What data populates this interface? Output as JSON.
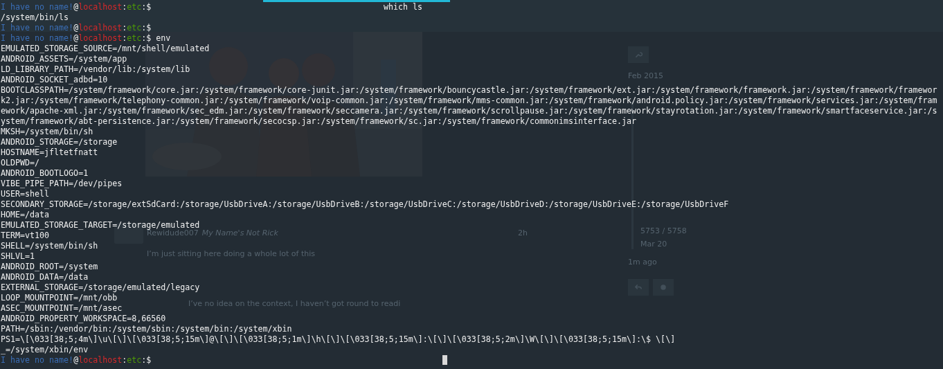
{
  "page": {
    "post": {
      "author": "Rewidude007",
      "author_title": "My Name's Not Rick",
      "age": "2h",
      "text": "I’m just sitting here doing a whole lot of this",
      "quote_text": "I’ve no idea on the context, I haven’t got round to readi"
    },
    "timeline": {
      "start": "Feb 2015",
      "position": "5753 / 5758",
      "date": "Mar 20",
      "ago": "1m ago"
    }
  },
  "terminal": {
    "title": "which ls",
    "lines": [
      {
        "kind": "prompt",
        "parts": [
          {
            "text": "I have no name!",
            "color": "#3a6db5"
          },
          {
            "text": "@",
            "color": "#f0f0f0"
          },
          {
            "text": "localhost",
            "color": "#d6282a"
          },
          {
            "text": ":"
          },
          {
            "text": "etc",
            "color": "#4e9a06"
          },
          {
            "text": ":$",
            "color": "#f0f0f0"
          }
        ]
      },
      {
        "kind": "output",
        "text": "/system/bin/ls"
      },
      {
        "kind": "prompt",
        "parts": [
          {
            "text": "I have no name!",
            "color": "#3a6db5"
          },
          {
            "text": "@",
            "color": "#f0f0f0"
          },
          {
            "text": "localhost",
            "color": "#d6282a"
          },
          {
            "text": ":"
          },
          {
            "text": "etc",
            "color": "#4e9a06"
          },
          {
            "text": ":$",
            "color": "#f0f0f0"
          }
        ]
      },
      {
        "kind": "prompt",
        "parts": [
          {
            "text": "I have no name!",
            "color": "#3a6db5"
          },
          {
            "text": "@",
            "color": "#f0f0f0"
          },
          {
            "text": "localhost",
            "color": "#d6282a"
          },
          {
            "text": ":"
          },
          {
            "text": "etc",
            "color": "#4e9a06"
          },
          {
            "text": ":$",
            "color": "#f0f0f0"
          }
        ],
        "command": "env"
      },
      {
        "kind": "output",
        "text": "EMULATED_STORAGE_SOURCE=/mnt/shell/emulated"
      },
      {
        "kind": "output",
        "text": "ANDROID_ASSETS=/system/app"
      },
      {
        "kind": "output",
        "text": "LD_LIBRARY_PATH=/vendor/lib:/system/lib"
      },
      {
        "kind": "output",
        "text": "ANDROID_SOCKET_adbd=10"
      },
      {
        "kind": "output",
        "text": "BOOTCLASSPATH=/system/framework/core.jar:/system/framework/core-junit.jar:/system/framework/bouncycastle.jar:/system/framework/ext.jar:/system/framework/framework.jar:/system/framework/framewor"
      },
      {
        "kind": "output",
        "text": "k2.jar:/system/framework/telephony-common.jar:/system/framework/voip-common.jar:/system/framework/mms-common.jar:/system/framework/android.policy.jar:/system/framework/services.jar:/system/fram"
      },
      {
        "kind": "output",
        "text": "ework/apache-xml.jar:/system/framework/sec_edm.jar:/system/framework/seccamera.jar:/system/framework/scrollpause.jar:/system/framework/stayrotation.jar:/system/framework/smartfaceservice.jar:/s"
      },
      {
        "kind": "output",
        "text": "ystem/framework/abt-persistence.jar:/system/framework/secocsp.jar:/system/framework/sc.jar:/system/framework/commonimsinterface.jar"
      },
      {
        "kind": "output",
        "text": "MKSH=/system/bin/sh"
      },
      {
        "kind": "output",
        "text": "ANDROID_STORAGE=/storage"
      },
      {
        "kind": "output",
        "text": "HOSTNAME=jfltetfnatt"
      },
      {
        "kind": "output",
        "text": "OLDPWD=/"
      },
      {
        "kind": "output",
        "text": "ANDROID_BOOTLOGO=1"
      },
      {
        "kind": "output",
        "text": "VIBE_PIPE_PATH=/dev/pipes"
      },
      {
        "kind": "output",
        "text": "USER=shell"
      },
      {
        "kind": "output",
        "text": "SECONDARY_STORAGE=/storage/extSdCard:/storage/UsbDriveA:/storage/UsbDriveB:/storage/UsbDriveC:/storage/UsbDriveD:/storage/UsbDriveE:/storage/UsbDriveF"
      },
      {
        "kind": "output",
        "text": "HOME=/data"
      },
      {
        "kind": "output",
        "text": "EMULATED_STORAGE_TARGET=/storage/emulated"
      },
      {
        "kind": "output",
        "text": "TERM=vt100"
      },
      {
        "kind": "output",
        "text": "SHELL=/system/bin/sh"
      },
      {
        "kind": "output",
        "text": "SHLVL=1"
      },
      {
        "kind": "output",
        "text": "ANDROID_ROOT=/system"
      },
      {
        "kind": "output",
        "text": "ANDROID_DATA=/data"
      },
      {
        "kind": "output",
        "text": "EXTERNAL_STORAGE=/storage/emulated/legacy"
      },
      {
        "kind": "output",
        "text": "LOOP_MOUNTPOINT=/mnt/obb"
      },
      {
        "kind": "output",
        "text": "ASEC_MOUNTPOINT=/mnt/asec"
      },
      {
        "kind": "output",
        "text": "ANDROID_PROPERTY_WORKSPACE=8,66560"
      },
      {
        "kind": "output",
        "text": "PATH=/sbin:/vendor/bin:/system/sbin:/system/bin:/system/xbin"
      },
      {
        "kind": "output",
        "text": "PS1=\\[\\033[38;5;4m\\]\\u\\[\\]\\[\\033[38;5;15m\\]@\\[\\]\\[\\033[38;5;1m\\]\\h\\[\\]\\[\\033[38;5;15m\\]:\\[\\]\\[\\033[38;5;2m\\]\\W\\[\\]\\[\\033[38;5;15m\\]:\\$ \\[\\]"
      },
      {
        "kind": "output",
        "text": "_=/system/xbin/env"
      },
      {
        "kind": "prompt",
        "parts": [
          {
            "text": "I have no name!",
            "color": "#3a6db5"
          },
          {
            "text": "@",
            "color": "#f0f0f0"
          },
          {
            "text": "localhost",
            "color": "#d6282a"
          },
          {
            "text": ":"
          },
          {
            "text": "etc",
            "color": "#4e9a06"
          },
          {
            "text": ":$",
            "color": "#f0f0f0"
          }
        ],
        "cursor": true
      }
    ]
  }
}
